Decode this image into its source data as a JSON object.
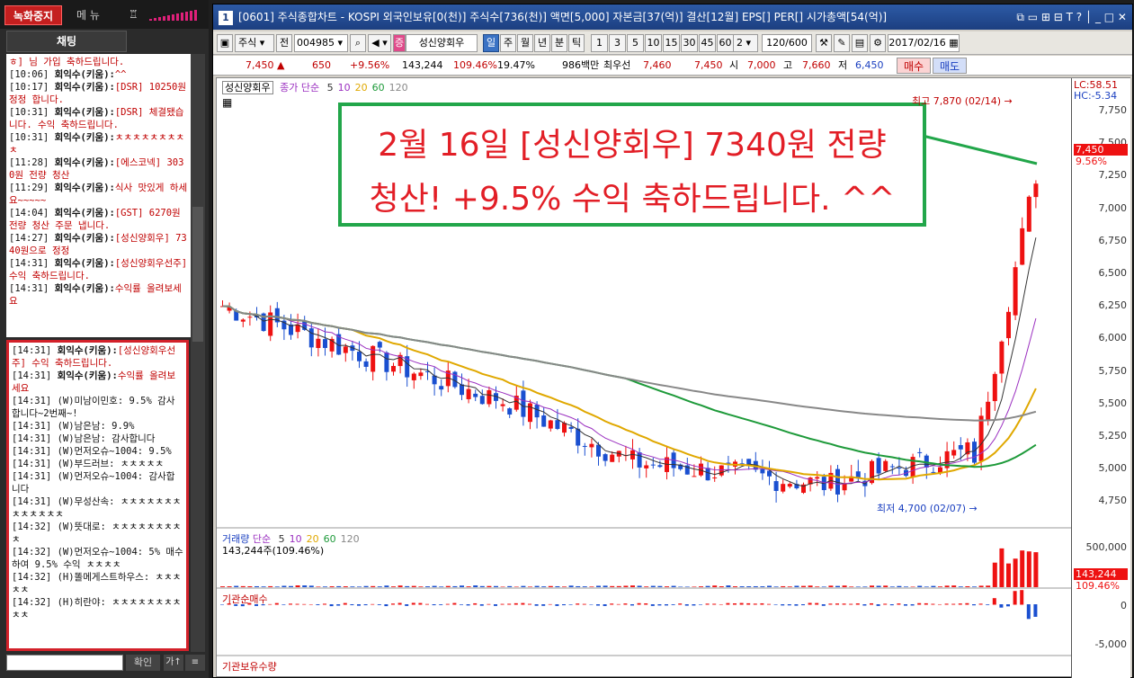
{
  "left_panel": {
    "record_button": "녹화중지",
    "menu_button": "메 뉴",
    "chat_tab": "채팅",
    "top_messages": [
      {
        "t": "",
        "n": "",
        "m": "ㅎ] 님 가입 축하드립니다.",
        "red": true
      },
      {
        "t": "[10:06]",
        "n": "회익수(키움):",
        "m": "^^",
        "red": true
      },
      {
        "t": "[10:17]",
        "n": "회익수(키움):",
        "m": "[DSR] 10250원 정정 합니다.",
        "red": true
      },
      {
        "t": "[10:31]",
        "n": "회익수(키움):",
        "m": "[DSR] 체결됐습니다. 수익 축하드립니다.",
        "red": true
      },
      {
        "t": "[10:31]",
        "n": "회익수(키움):",
        "m": "ㅊㅊㅊㅊㅊㅊㅊㅊㅊ",
        "red": true
      },
      {
        "t": "[11:28]",
        "n": "회익수(키움):",
        "m": "[에스코넥] 3030원 전량 청산",
        "red": true
      },
      {
        "t": "[11:29]",
        "n": "회익수(키움):",
        "m": "식사 맛있게 하세요~~~~~",
        "red": true
      },
      {
        "t": "[14:04]",
        "n": "회익수(키움):",
        "m": "[GST] 6270원 전량 청산 주문 냅니다.",
        "red": true
      },
      {
        "t": "[14:27]",
        "n": "회익수(키움):",
        "m": "[성신양회우] 7340원으로 정정",
        "red": true
      },
      {
        "t": "[14:31]",
        "n": "회익수(키움):",
        "m": "[성신양회우선주] 수익 축하드립니다.",
        "red": true
      },
      {
        "t": "[14:31]",
        "n": "회익수(키움):",
        "m": "수익률 올려보세요",
        "red": true
      }
    ],
    "bottom_messages": [
      {
        "t": "[14:31]",
        "n": "회익수(키움):",
        "m": "[성신양회우선주] 수익 축하드립니다.",
        "red": true
      },
      {
        "t": "[14:31]",
        "n": "회익수(키움):",
        "m": "수익률 올려보세요",
        "red": true
      },
      {
        "t": "[14:31]",
        "n": "",
        "m": "(W)미남이민호: 9.5% 감사합니다~2번째~!",
        "red": false
      },
      {
        "t": "[14:31]",
        "n": "",
        "m": "(W)남은남: 9.9%",
        "red": false
      },
      {
        "t": "[14:31]",
        "n": "",
        "m": "(W)남은남: 감사합니다",
        "red": false
      },
      {
        "t": "[14:31]",
        "n": "",
        "m": "(W)먼저오슈~1004: 9.5%",
        "red": false
      },
      {
        "t": "[14:31]",
        "n": "",
        "m": "(W)부드러브: ㅊㅊㅊㅊㅊ",
        "red": false
      },
      {
        "t": "[14:31]",
        "n": "",
        "m": "(W)먼저오슈~1004: 감사합니다",
        "red": false
      },
      {
        "t": "[14:31]",
        "n": "",
        "m": "(W)무성산속: ㅊㅊㅊㅊㅊㅊㅊㅊㅊㅊㅊㅊㅊ",
        "red": false
      },
      {
        "t": "[14:32]",
        "n": "",
        "m": "(W)뜻대로: ㅊㅊㅊㅊㅊㅊㅊㅊㅊ",
        "red": false
      },
      {
        "t": "[14:32]",
        "n": "",
        "m": "(W)먼저오슈~1004: 5% 매수 하여 9.5% 수익 ㅊㅊㅊㅊ",
        "red": false
      },
      {
        "t": "[14:32]",
        "n": "",
        "m": "(H)똘메게스트하우스: ㅊㅊㅊㅊㅊ",
        "red": false
      },
      {
        "t": "[14:32]",
        "n": "",
        "m": "(H)히란야: ㅊㅊㅊㅊㅊㅊㅊㅊㅊㅊ",
        "red": false
      }
    ],
    "confirm_button": "확인",
    "font_button": "가↑",
    "list_button": "≡"
  },
  "window": {
    "number": "1",
    "title": "[0601] 주식종합차트 - KOSPI 외국인보유[0(천)] 주식수[736(천)] 액면[5,000] 자본금[37(억)] 결산[12월] EPS[] PER[] 시가총액[54(억)]",
    "title_icons": "⧉ ▭ ⊞ ⊟ T ? │ _ □ ✕"
  },
  "toolbar": {
    "market": "주식",
    "prev": "전",
    "code": "004985",
    "stock_name": "성신양회우",
    "periods": [
      "일",
      "주",
      "월",
      "년",
      "분",
      "틱"
    ],
    "minutes": [
      "1",
      "3",
      "5",
      "10",
      "15",
      "30",
      "45",
      "60"
    ],
    "min_sel": "2",
    "count": "120/600",
    "date": "2017/02/16"
  },
  "quote": {
    "price": "7,450 ▲",
    "change": "650",
    "pct": "+9.56%",
    "volume": "143,244",
    "vol_ratio": "109.46%",
    "turnover": "19.47%",
    "amount": "986백만",
    "ask_label": "최우선",
    "ask": "7,460",
    "bid": "7,450",
    "open_label": "시",
    "open": "7,000",
    "high_label": "고",
    "high": "7,660",
    "low_label": "저",
    "low": "6,450",
    "buy": "매수",
    "sell": "매도"
  },
  "chart": {
    "legend_name": "성신양회우",
    "legend_ma": "종가 단순",
    "ma_periods": [
      "5",
      "10",
      "20",
      "60",
      "120"
    ],
    "ma_colors": [
      "#333333",
      "#9b30c0",
      "#e0a800",
      "#1e9a3a",
      "#888888"
    ],
    "lc": "LC:58.51",
    "hc": "HC:-5.34",
    "price_tag": "7,450",
    "pct_tag": "9.56%",
    "high_note": "최고 7,870 (02/14) →",
    "low_note": "최저 4,700 (02/07) →",
    "yticks": [
      "7,750",
      "7,500",
      "7,250",
      "7,000",
      "6,750",
      "6,500",
      "6,250",
      "6,000",
      "5,750",
      "5,500",
      "5,250",
      "5,000",
      "4,750"
    ],
    "annotation_line1": "2월 16일 [성신양회우] 7340원 전량",
    "annotation_line2": "청산! +9.5% 수익 축하드립니다. ^^",
    "vol_legend": "거래량",
    "vol_ma": "단순",
    "vol_value": "143,244주(109.46%)",
    "vol_ticks": [
      "500,000"
    ],
    "vol_tag1": "143,244",
    "vol_tag2": "109.46%",
    "inst_label": "기관순매수",
    "inst_ticks": [
      "0",
      "-5,000"
    ],
    "hold_label": "기관보유수량"
  }
}
